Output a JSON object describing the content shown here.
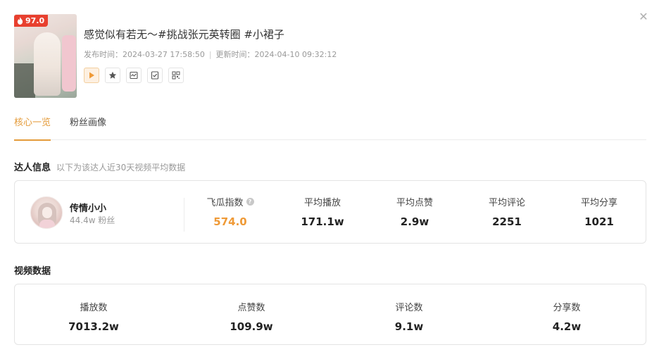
{
  "header": {
    "score_badge": "97.0",
    "video_title": "感觉似有若无～#挑战张元英转圈 #小裙子",
    "publish_label": "发布时间：",
    "publish_time": "2024-03-27 17:58:50",
    "separator": "|",
    "update_label": "更新时间：",
    "update_time": "2024-04-10 09:32:12",
    "close_icon": "close-icon",
    "actions": [
      {
        "icon": "play-icon",
        "active": true
      },
      {
        "icon": "star-icon",
        "active": false
      },
      {
        "icon": "chart-icon",
        "active": false
      },
      {
        "icon": "checklist-icon",
        "active": false
      },
      {
        "icon": "qrcode-icon",
        "active": false
      }
    ],
    "accent_color": "#e49b3a",
    "badge_color": "#e8402f"
  },
  "tabs": [
    {
      "label": "核心一览",
      "active": true
    },
    {
      "label": "粉丝画像",
      "active": false
    }
  ],
  "influencer_section": {
    "title": "达人信息",
    "subtitle": "以下为该达人近30天视频平均数据",
    "name": "传情小小",
    "fans": "44.4w 粉丝",
    "stats": [
      {
        "label": "飞瓜指数",
        "value": "574.0",
        "help": "?",
        "accent": true
      },
      {
        "label": "平均播放",
        "value": "171.1w"
      },
      {
        "label": "平均点赞",
        "value": "2.9w"
      },
      {
        "label": "平均评论",
        "value": "2251"
      },
      {
        "label": "平均分享",
        "value": "1021"
      }
    ]
  },
  "video_section": {
    "title": "视频数据",
    "stats": [
      {
        "label": "播放数",
        "value": "7013.2w"
      },
      {
        "label": "点赞数",
        "value": "109.9w"
      },
      {
        "label": "评论数",
        "value": "9.1w"
      },
      {
        "label": "分享数",
        "value": "4.2w"
      }
    ]
  }
}
